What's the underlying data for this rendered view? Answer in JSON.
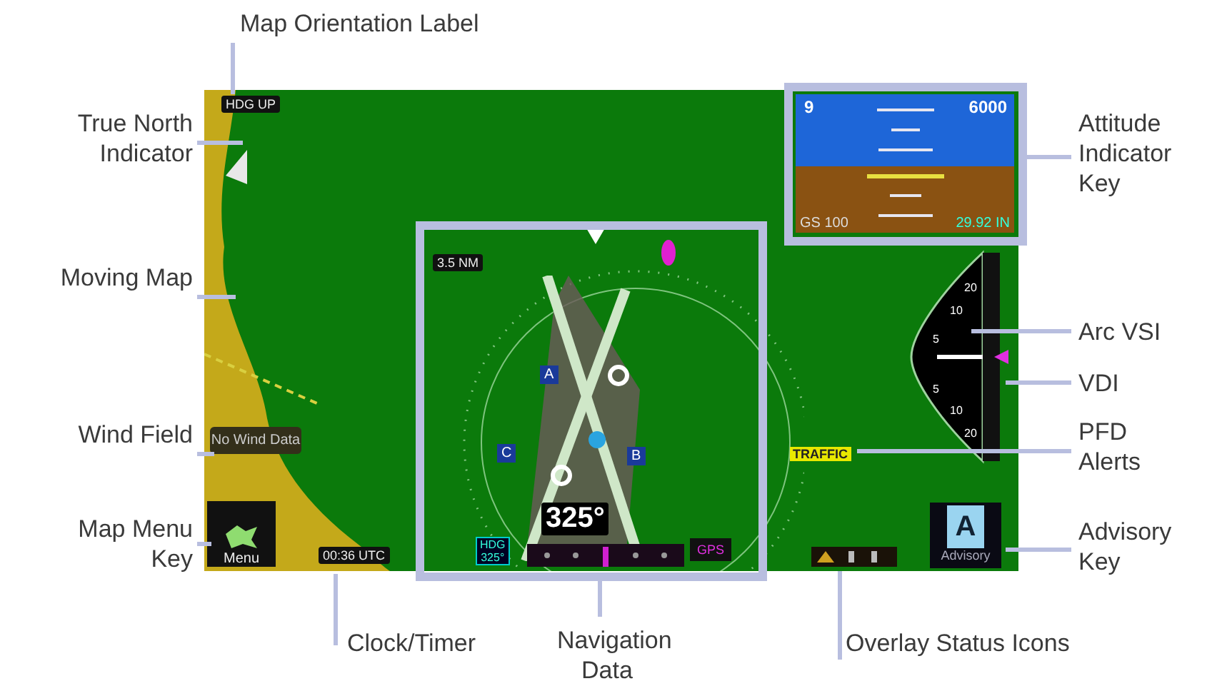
{
  "callouts": [
    {
      "text": "Map Orientation Label"
    },
    {
      "text": "True North Indicator"
    },
    {
      "text": "Moving Map"
    },
    {
      "text": "Wind Field"
    },
    {
      "text": "Map Menu Key"
    },
    {
      "text": "Clock/Timer"
    },
    {
      "text": "Navigation Data"
    },
    {
      "text": "Overlay Status Icons"
    },
    {
      "text": "Attitude Indicator Key"
    },
    {
      "text": "Arc VSI"
    },
    {
      "text": "VDI"
    },
    {
      "text": "PFD Alerts"
    },
    {
      "text": "Advisory Key"
    }
  ],
  "display": {
    "orientation_label": "HDG UP",
    "attitude": {
      "roll_readout": "9",
      "altitude": "6000",
      "ground_speed": "GS 100",
      "baro": "29.92 IN"
    },
    "map_scale": "3.5 NM",
    "taxiway_signs": [
      "A",
      "C",
      "B"
    ],
    "heading": "325°",
    "hdg_box": {
      "label": "HDG",
      "value": "325°"
    },
    "nav_source": "GPS",
    "vsi_ticks": [
      "20",
      "10",
      "5",
      "5",
      "10",
      "20"
    ],
    "alert": "TRAFFIC",
    "wind": "No Wind Data",
    "menu_button": "Menu",
    "clock": "00:36 UTC",
    "advisory": {
      "letter": "A",
      "label": "Advisory"
    }
  }
}
